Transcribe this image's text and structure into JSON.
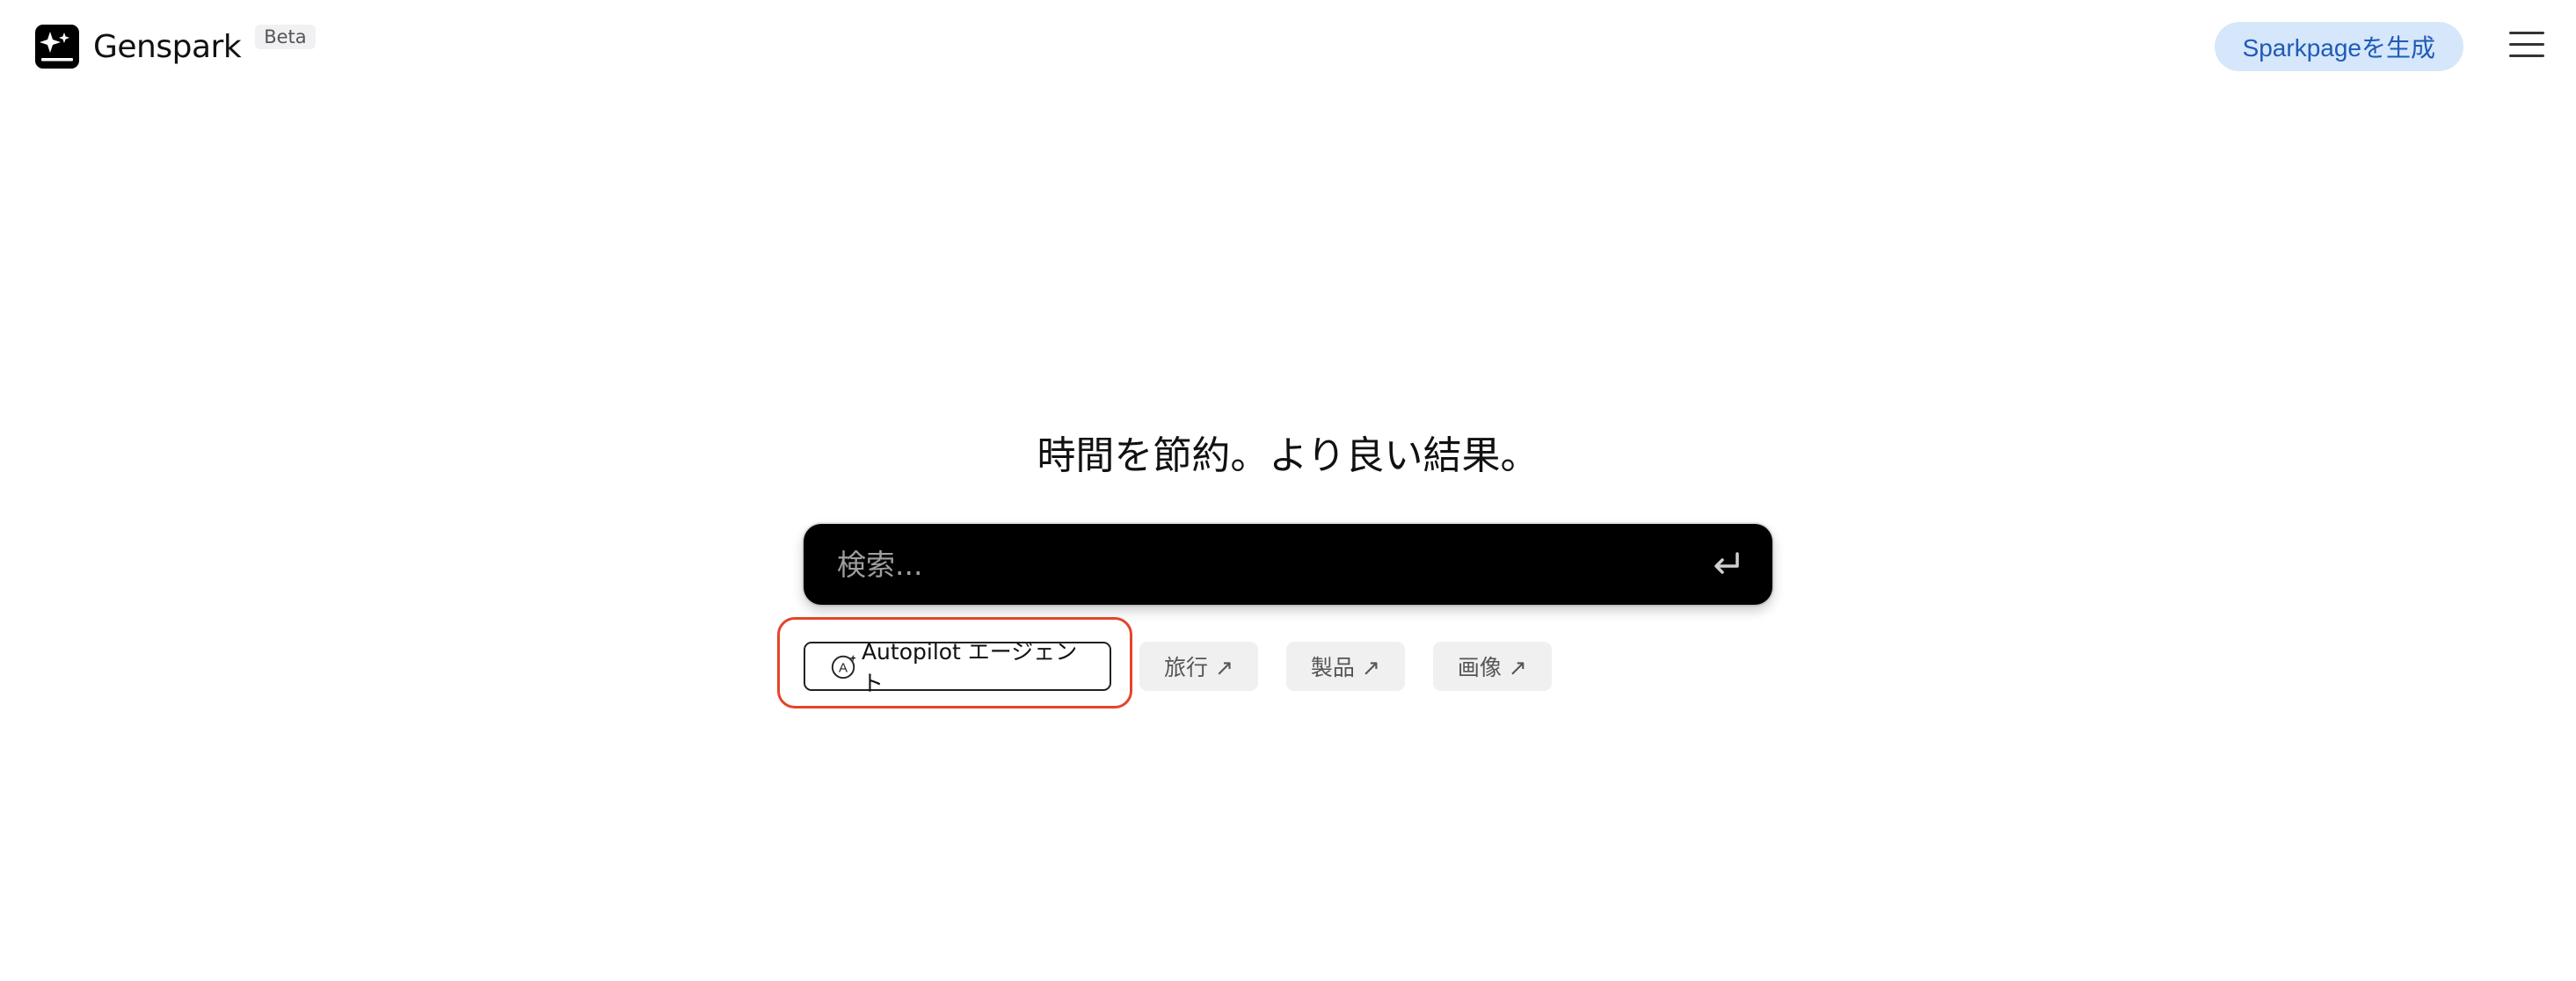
{
  "header": {
    "brand": "Genspark",
    "badge": "Beta",
    "cta_label": "Sparkpageを生成"
  },
  "hero": {
    "headline": "時間を節約。より良い結果。"
  },
  "search": {
    "placeholder": "検索..."
  },
  "chips": {
    "autopilot": "Autopilot エージェント",
    "travel": "旅行 ↗",
    "products": "製品 ↗",
    "images": "画像 ↗"
  },
  "icons": {
    "logo": "sparkle-logo-icon",
    "menu": "hamburger-menu-icon",
    "enter": "enter-return-icon",
    "agent": "autopilot-agent-icon"
  },
  "colors": {
    "accent_bg": "#d6e6fb",
    "accent_text": "#1e5bb5",
    "highlight": "#e4442b",
    "search_bg": "#000000"
  }
}
